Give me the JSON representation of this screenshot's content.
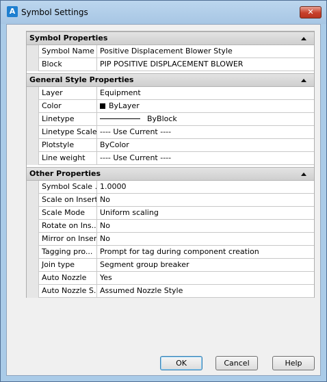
{
  "window": {
    "title": "Symbol Settings",
    "icon": "autocad-a-icon",
    "close_glyph": "✕"
  },
  "categories": [
    {
      "title": "Symbol Properties",
      "rows": [
        {
          "name": "Symbol Name",
          "value": "Positive Displacement Blower Style"
        },
        {
          "name": "Block",
          "value": "PIP POSITIVE DISPLACEMENT BLOWER"
        }
      ]
    },
    {
      "title": "General Style Properties",
      "rows": [
        {
          "name": "Layer",
          "value": "Equipment"
        },
        {
          "name": "Color",
          "value": "ByLayer",
          "swatch_color": "#000000"
        },
        {
          "name": "Linetype",
          "value": "ByBlock"
        },
        {
          "name": "Linetype Scale",
          "value": "---- Use Current ----"
        },
        {
          "name": "Plotstyle",
          "value": "ByColor"
        },
        {
          "name": "Line weight",
          "value": "---- Use Current ----"
        }
      ]
    },
    {
      "title": "Other Properties",
      "rows": [
        {
          "name": "Symbol Scale ...",
          "value": "1.0000"
        },
        {
          "name": "Scale on Insert",
          "value": "No"
        },
        {
          "name": "Scale Mode",
          "value": "Uniform scaling"
        },
        {
          "name": "Rotate on Ins...",
          "value": "No"
        },
        {
          "name": "Mirror on Insert",
          "value": "No"
        },
        {
          "name": "Tagging pro...",
          "value": "Prompt for tag during component creation"
        },
        {
          "name": "Join type",
          "value": "Segment group breaker"
        },
        {
          "name": "Auto Nozzle",
          "value": "Yes"
        },
        {
          "name": "Auto Nozzle S...",
          "value": "Assumed Nozzle Style"
        }
      ]
    }
  ],
  "buttons": {
    "ok": "OK",
    "cancel": "Cancel",
    "help": "Help"
  }
}
